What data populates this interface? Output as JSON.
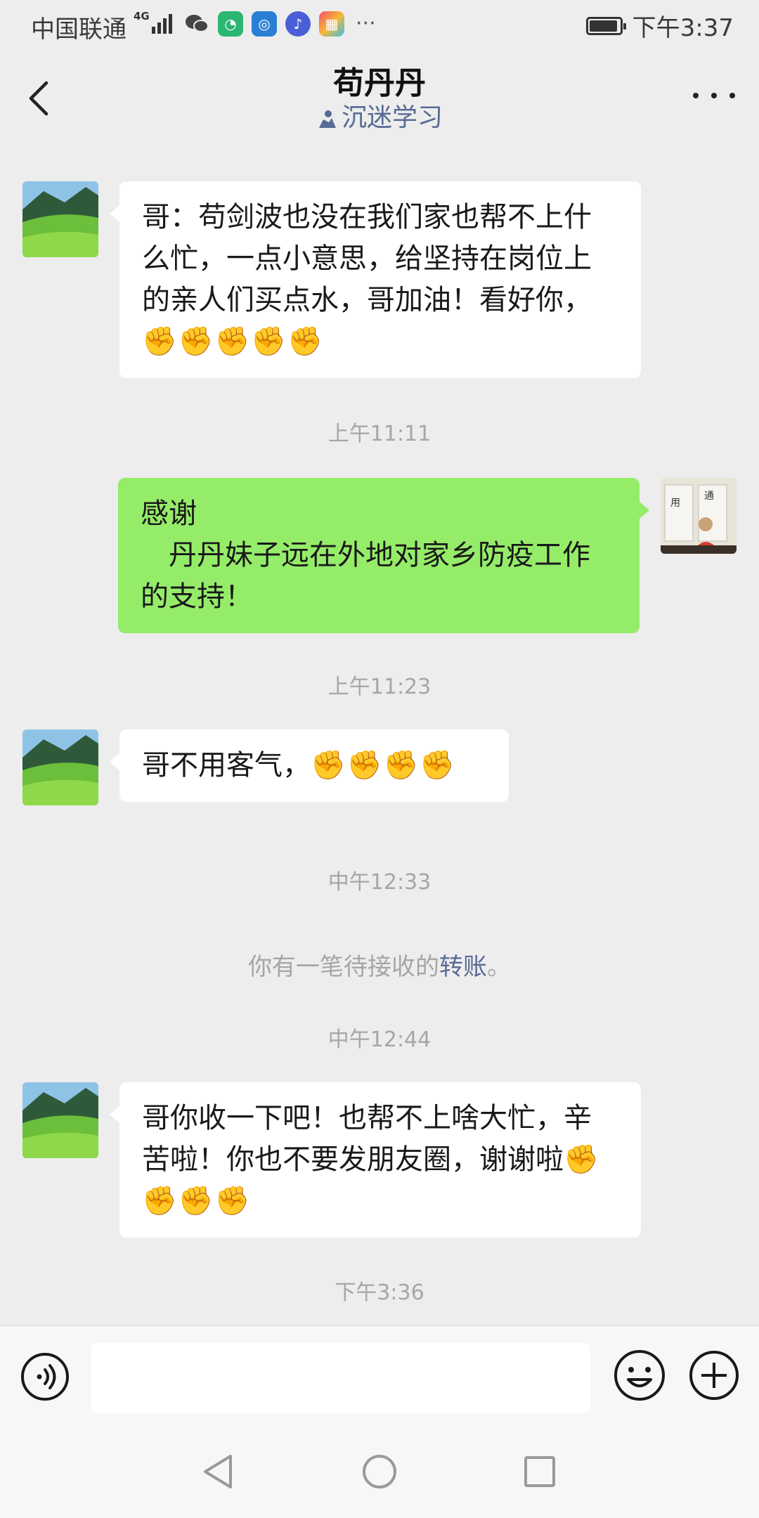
{
  "status_bar": {
    "carrier": "中国联通",
    "network": "4G",
    "time": "下午3:37",
    "battery_level": 0.95,
    "more": "···"
  },
  "header": {
    "title": "苟丹丹",
    "subtitle": "沉迷学习"
  },
  "messages": [
    {
      "from": "other",
      "text": "哥：苟剑波也没在我们家也帮不上什么忙，一点小意思，给坚持在岗位上的亲人们买点水，哥加油！看好你，",
      "emoji": "✊✊✊✊✊"
    },
    {
      "type": "time",
      "text": "上午11:11"
    },
    {
      "from": "me",
      "line1": "感谢",
      "line2": "　丹丹妹子远在外地对家乡防疫工作的支持！"
    },
    {
      "type": "time",
      "text": "上午11:23"
    },
    {
      "from": "other",
      "text": "哥不用客气，",
      "emoji": "✊✊✊✊"
    },
    {
      "type": "time",
      "text": "中午12:33"
    },
    {
      "type": "system",
      "before": "你有一笔待接收的",
      "link": "转账",
      "after": "。"
    },
    {
      "type": "time",
      "text": "中午12:44"
    },
    {
      "from": "other",
      "text": "哥你收一下吧！也帮不上啥大忙，辛苦啦！你也不要发朋友圈，谢谢啦",
      "emoji": "✊✊✊✊"
    },
    {
      "type": "time",
      "text": "下午3:36"
    }
  ],
  "input": {
    "value": "",
    "placeholder": ""
  },
  "colors": {
    "background": "#ededed",
    "bubble_me": "#95ec69",
    "bubble_other": "#ffffff",
    "link": "#576b95",
    "timestamp": "#a6a6a6"
  }
}
